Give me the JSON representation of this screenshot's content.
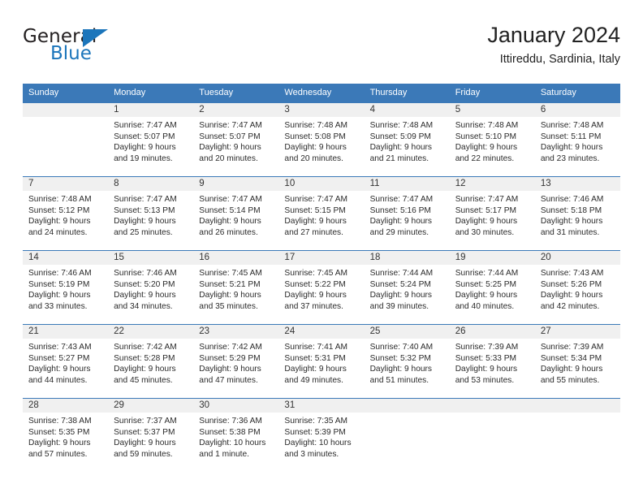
{
  "brand": {
    "name_part1": "General",
    "name_part2": "Blue",
    "logo_icon": "blue-triangle",
    "accent_color": "#1b75bb"
  },
  "header": {
    "title": "January 2024",
    "subtitle": "Ittireddu, Sardinia, Italy"
  },
  "theme": {
    "header_row_bg": "#3b79b8",
    "daynum_band_bg": "#f0f0f0",
    "grid_line": "#3b79b8",
    "text": "#2b2b2b"
  },
  "weekdays": [
    "Sunday",
    "Monday",
    "Tuesday",
    "Wednesday",
    "Thursday",
    "Friday",
    "Saturday"
  ],
  "labels": {
    "sunrise_prefix": "Sunrise:",
    "sunset_prefix": "Sunset:",
    "daylight_prefix": "Daylight:"
  },
  "weeks": [
    [
      {
        "empty": true
      },
      {
        "day": "1",
        "sunrise": "Sunrise: 7:47 AM",
        "sunset": "Sunset: 5:07 PM",
        "daylight1": "Daylight: 9 hours",
        "daylight2": "and 19 minutes."
      },
      {
        "day": "2",
        "sunrise": "Sunrise: 7:47 AM",
        "sunset": "Sunset: 5:07 PM",
        "daylight1": "Daylight: 9 hours",
        "daylight2": "and 20 minutes."
      },
      {
        "day": "3",
        "sunrise": "Sunrise: 7:48 AM",
        "sunset": "Sunset: 5:08 PM",
        "daylight1": "Daylight: 9 hours",
        "daylight2": "and 20 minutes."
      },
      {
        "day": "4",
        "sunrise": "Sunrise: 7:48 AM",
        "sunset": "Sunset: 5:09 PM",
        "daylight1": "Daylight: 9 hours",
        "daylight2": "and 21 minutes."
      },
      {
        "day": "5",
        "sunrise": "Sunrise: 7:48 AM",
        "sunset": "Sunset: 5:10 PM",
        "daylight1": "Daylight: 9 hours",
        "daylight2": "and 22 minutes."
      },
      {
        "day": "6",
        "sunrise": "Sunrise: 7:48 AM",
        "sunset": "Sunset: 5:11 PM",
        "daylight1": "Daylight: 9 hours",
        "daylight2": "and 23 minutes."
      }
    ],
    [
      {
        "day": "7",
        "sunrise": "Sunrise: 7:48 AM",
        "sunset": "Sunset: 5:12 PM",
        "daylight1": "Daylight: 9 hours",
        "daylight2": "and 24 minutes."
      },
      {
        "day": "8",
        "sunrise": "Sunrise: 7:47 AM",
        "sunset": "Sunset: 5:13 PM",
        "daylight1": "Daylight: 9 hours",
        "daylight2": "and 25 minutes."
      },
      {
        "day": "9",
        "sunrise": "Sunrise: 7:47 AM",
        "sunset": "Sunset: 5:14 PM",
        "daylight1": "Daylight: 9 hours",
        "daylight2": "and 26 minutes."
      },
      {
        "day": "10",
        "sunrise": "Sunrise: 7:47 AM",
        "sunset": "Sunset: 5:15 PM",
        "daylight1": "Daylight: 9 hours",
        "daylight2": "and 27 minutes."
      },
      {
        "day": "11",
        "sunrise": "Sunrise: 7:47 AM",
        "sunset": "Sunset: 5:16 PM",
        "daylight1": "Daylight: 9 hours",
        "daylight2": "and 29 minutes."
      },
      {
        "day": "12",
        "sunrise": "Sunrise: 7:47 AM",
        "sunset": "Sunset: 5:17 PM",
        "daylight1": "Daylight: 9 hours",
        "daylight2": "and 30 minutes."
      },
      {
        "day": "13",
        "sunrise": "Sunrise: 7:46 AM",
        "sunset": "Sunset: 5:18 PM",
        "daylight1": "Daylight: 9 hours",
        "daylight2": "and 31 minutes."
      }
    ],
    [
      {
        "day": "14",
        "sunrise": "Sunrise: 7:46 AM",
        "sunset": "Sunset: 5:19 PM",
        "daylight1": "Daylight: 9 hours",
        "daylight2": "and 33 minutes."
      },
      {
        "day": "15",
        "sunrise": "Sunrise: 7:46 AM",
        "sunset": "Sunset: 5:20 PM",
        "daylight1": "Daylight: 9 hours",
        "daylight2": "and 34 minutes."
      },
      {
        "day": "16",
        "sunrise": "Sunrise: 7:45 AM",
        "sunset": "Sunset: 5:21 PM",
        "daylight1": "Daylight: 9 hours",
        "daylight2": "and 35 minutes."
      },
      {
        "day": "17",
        "sunrise": "Sunrise: 7:45 AM",
        "sunset": "Sunset: 5:22 PM",
        "daylight1": "Daylight: 9 hours",
        "daylight2": "and 37 minutes."
      },
      {
        "day": "18",
        "sunrise": "Sunrise: 7:44 AM",
        "sunset": "Sunset: 5:24 PM",
        "daylight1": "Daylight: 9 hours",
        "daylight2": "and 39 minutes."
      },
      {
        "day": "19",
        "sunrise": "Sunrise: 7:44 AM",
        "sunset": "Sunset: 5:25 PM",
        "daylight1": "Daylight: 9 hours",
        "daylight2": "and 40 minutes."
      },
      {
        "day": "20",
        "sunrise": "Sunrise: 7:43 AM",
        "sunset": "Sunset: 5:26 PM",
        "daylight1": "Daylight: 9 hours",
        "daylight2": "and 42 minutes."
      }
    ],
    [
      {
        "day": "21",
        "sunrise": "Sunrise: 7:43 AM",
        "sunset": "Sunset: 5:27 PM",
        "daylight1": "Daylight: 9 hours",
        "daylight2": "and 44 minutes."
      },
      {
        "day": "22",
        "sunrise": "Sunrise: 7:42 AM",
        "sunset": "Sunset: 5:28 PM",
        "daylight1": "Daylight: 9 hours",
        "daylight2": "and 45 minutes."
      },
      {
        "day": "23",
        "sunrise": "Sunrise: 7:42 AM",
        "sunset": "Sunset: 5:29 PM",
        "daylight1": "Daylight: 9 hours",
        "daylight2": "and 47 minutes."
      },
      {
        "day": "24",
        "sunrise": "Sunrise: 7:41 AM",
        "sunset": "Sunset: 5:31 PM",
        "daylight1": "Daylight: 9 hours",
        "daylight2": "and 49 minutes."
      },
      {
        "day": "25",
        "sunrise": "Sunrise: 7:40 AM",
        "sunset": "Sunset: 5:32 PM",
        "daylight1": "Daylight: 9 hours",
        "daylight2": "and 51 minutes."
      },
      {
        "day": "26",
        "sunrise": "Sunrise: 7:39 AM",
        "sunset": "Sunset: 5:33 PM",
        "daylight1": "Daylight: 9 hours",
        "daylight2": "and 53 minutes."
      },
      {
        "day": "27",
        "sunrise": "Sunrise: 7:39 AM",
        "sunset": "Sunset: 5:34 PM",
        "daylight1": "Daylight: 9 hours",
        "daylight2": "and 55 minutes."
      }
    ],
    [
      {
        "day": "28",
        "sunrise": "Sunrise: 7:38 AM",
        "sunset": "Sunset: 5:35 PM",
        "daylight1": "Daylight: 9 hours",
        "daylight2": "and 57 minutes."
      },
      {
        "day": "29",
        "sunrise": "Sunrise: 7:37 AM",
        "sunset": "Sunset: 5:37 PM",
        "daylight1": "Daylight: 9 hours",
        "daylight2": "and 59 minutes."
      },
      {
        "day": "30",
        "sunrise": "Sunrise: 7:36 AM",
        "sunset": "Sunset: 5:38 PM",
        "daylight1": "Daylight: 10 hours",
        "daylight2": "and 1 minute."
      },
      {
        "day": "31",
        "sunrise": "Sunrise: 7:35 AM",
        "sunset": "Sunset: 5:39 PM",
        "daylight1": "Daylight: 10 hours",
        "daylight2": "and 3 minutes."
      },
      {
        "empty": true
      },
      {
        "empty": true
      },
      {
        "empty": true
      }
    ]
  ]
}
